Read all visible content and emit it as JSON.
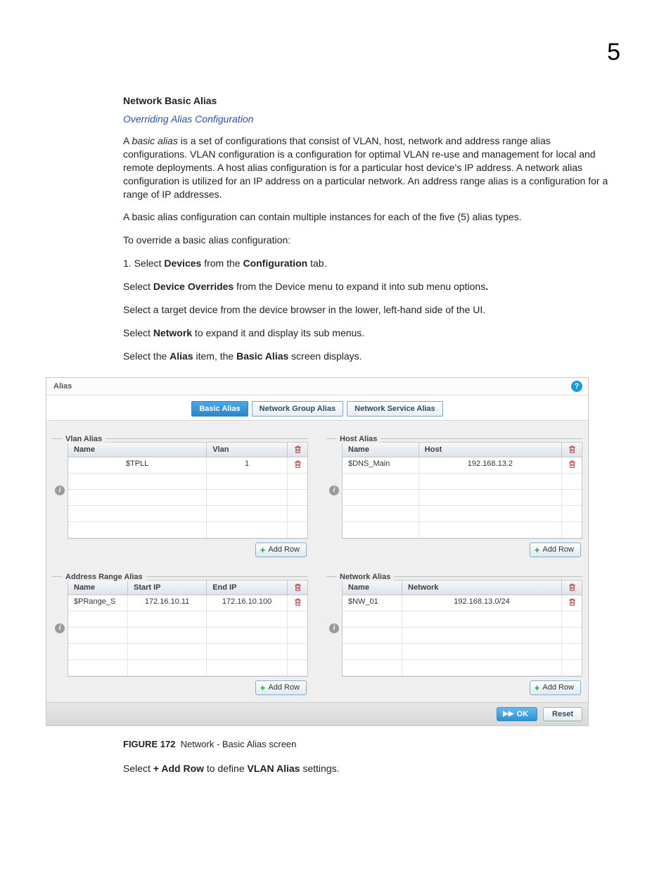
{
  "page_number": "5",
  "heading": "Network Basic Alias",
  "subheading": "Overriding Alias Configuration",
  "para1_prefix": "A ",
  "para1_em": "basic alias",
  "para1_rest": " is a set of configurations that consist of VLAN, host, network and address range alias configurations. VLAN configuration is a configuration for optimal VLAN re-use and management for local and remote deployments. A host alias configuration is for a particular host device's IP address. A network alias configuration is utilized for an IP address on a particular network. An address range alias is a configuration for a range of IP addresses.",
  "para2": "A basic alias configuration can contain multiple instances for each of the five (5) alias types.",
  "para3": "To override a basic alias configuration:",
  "step1_pre": "1.    Select ",
  "step1_b1": "Devices",
  "step1_mid": " from the ",
  "step1_b2": "Configuration",
  "step1_end": " tab.",
  "para4_pre": "Select ",
  "para4_b": "Device Overrides",
  "para4_rest": " from the Device menu to expand it into sub menu options",
  "para4_dot": ".",
  "para5": "Select a target device from the device browser in the lower, left-hand side of the UI.",
  "para6_pre": "Select ",
  "para6_b": "Network",
  "para6_rest": " to expand it and display its sub menus.",
  "para7_pre": "Select the ",
  "para7_b1": "Alias",
  "para7_mid": " item, the ",
  "para7_b2": "Basic Alias",
  "para7_end": " screen displays.",
  "screenshot": {
    "title": "Alias",
    "tabs": [
      "Basic Alias",
      "Network Group Alias",
      "Network Service Alias"
    ],
    "vlan_panel": {
      "title": "Vlan Alias",
      "cols": [
        "Name",
        "Vlan"
      ],
      "rows": [
        {
          "name": "$TPLL",
          "vlan": "1"
        }
      ],
      "add_label": "Add Row"
    },
    "host_panel": {
      "title": "Host Alias",
      "cols": [
        "Name",
        "Host"
      ],
      "rows": [
        {
          "name": "$DNS_Main",
          "host": "192.168.13.2"
        }
      ],
      "add_label": "Add Row"
    },
    "addr_panel": {
      "title": "Address Range Alias",
      "cols": [
        "Name",
        "Start IP",
        "End IP"
      ],
      "rows": [
        {
          "name": "$PRange_S",
          "start": "172.16.10.11",
          "end": "172.16.10.100"
        }
      ],
      "add_label": "Add Row"
    },
    "net_panel": {
      "title": "Network Alias",
      "cols": [
        "Name",
        "Network"
      ],
      "rows": [
        {
          "name": "$NW_01",
          "network": "192.168.13.0/24"
        }
      ],
      "add_label": "Add Row"
    },
    "ok_label": "OK",
    "reset_label": "Reset"
  },
  "figure_label": "FIGURE 172",
  "figure_caption": "Network - Basic Alias screen",
  "closing_pre": "Select ",
  "closing_b1": "+ Add Row",
  "closing_mid": " to define ",
  "closing_b2": "VLAN Alias",
  "closing_end": " settings."
}
